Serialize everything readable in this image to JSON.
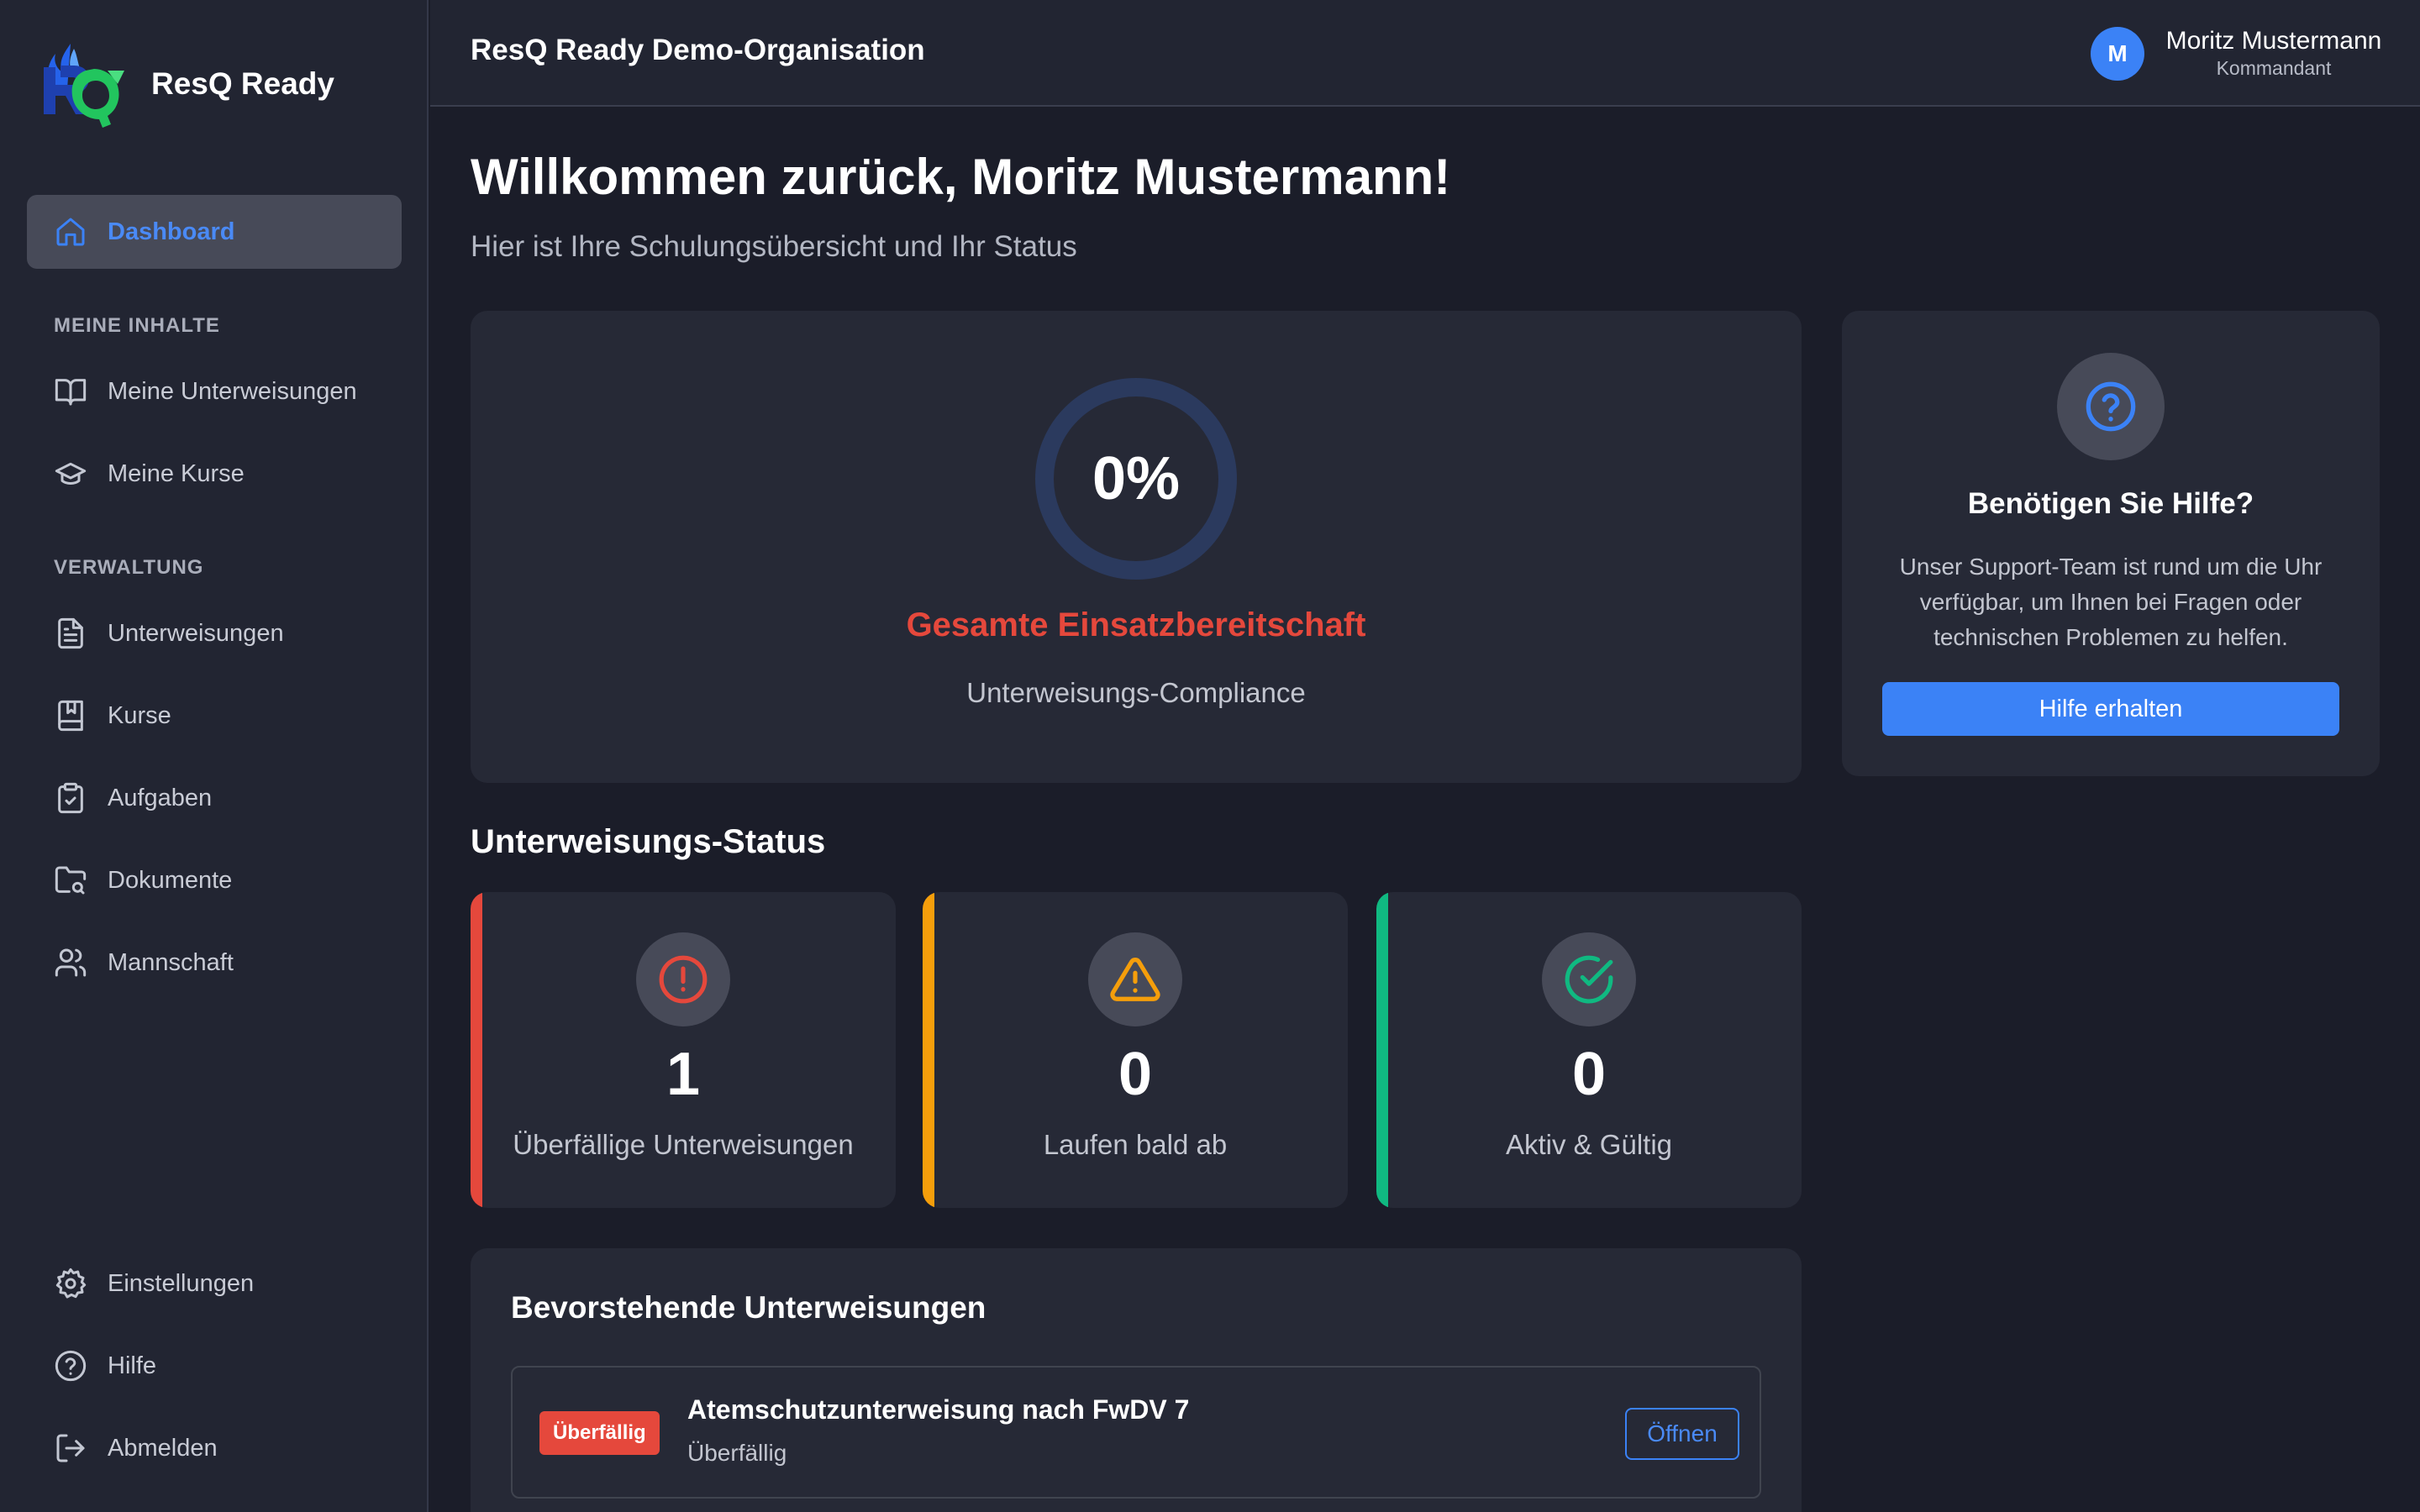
{
  "brand": {
    "name": "ResQ Ready"
  },
  "sidebar": {
    "dashboard": "Dashboard",
    "section_my": "MEINE INHALTE",
    "my_instructions": "Meine Unterweisungen",
    "my_courses": "Meine Kurse",
    "section_admin": "VERWALTUNG",
    "instructions": "Unterweisungen",
    "courses": "Kurse",
    "tasks": "Aufgaben",
    "documents": "Dokumente",
    "team": "Mannschaft",
    "settings": "Einstellungen",
    "help": "Hilfe",
    "logout": "Abmelden"
  },
  "header": {
    "org_title": "ResQ Ready Demo-Organisation",
    "avatar_initial": "M",
    "user_name": "Moritz Mustermann",
    "user_role": "Kommandant"
  },
  "main": {
    "welcome": "Willkommen zurück, Moritz Mustermann!",
    "subtitle": "Hier ist Ihre Schulungsübersicht und Ihr Status"
  },
  "readiness": {
    "value_label": "0%",
    "value_fraction": 0,
    "title": "Gesamte Einsatzbereitschaft",
    "subtitle": "Unterweisungs-Compliance"
  },
  "help_card": {
    "title": "Benötigen Sie Hilfe?",
    "text": "Unser Support-Team ist rund um die Uhr verfügbar, um Ihnen bei Fragen oder technischen Problemen zu helfen.",
    "button": "Hilfe erhalten"
  },
  "status": {
    "title": "Unterweisungs-Status",
    "overdue": {
      "count": "1",
      "label": "Überfällige Unterweisungen"
    },
    "expiring": {
      "count": "0",
      "label": "Laufen bald ab"
    },
    "active": {
      "count": "0",
      "label": "Aktiv & Gültig"
    }
  },
  "colors": {
    "accent": "#3b82f6",
    "danger": "#e5483c",
    "warning": "#f59e0b",
    "success": "#10b981"
  },
  "upcoming": {
    "title": "Bevorstehende Unterweisungen",
    "items": [
      {
        "badge": "Überfällig",
        "title": "Atemschutzunterweisung nach FwDV 7",
        "status": "Überfällig",
        "action": "Öffnen"
      }
    ]
  }
}
